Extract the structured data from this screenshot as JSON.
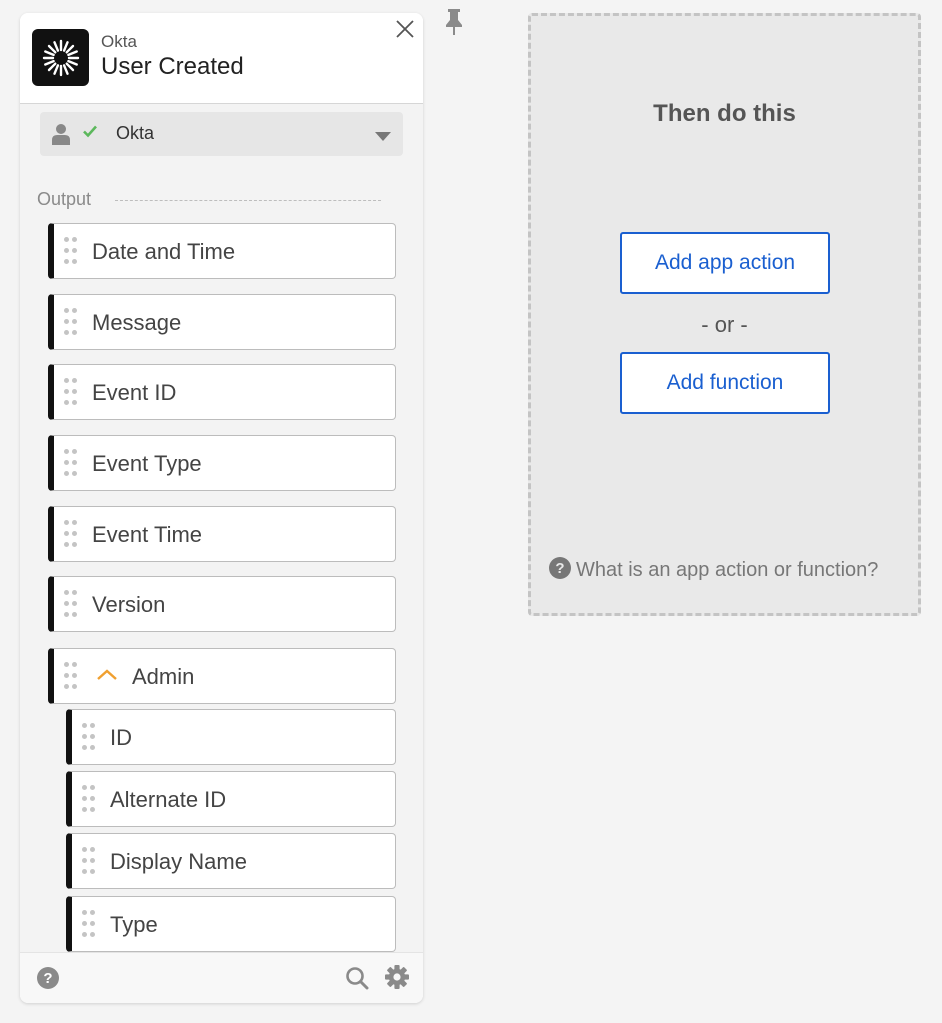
{
  "trigger": {
    "app_name": "Okta",
    "event_title": "User Created",
    "logo_icon": "okta-sunburst-logo",
    "account": {
      "name": "Okta",
      "status": "connected",
      "status_color": "#5cb85c"
    }
  },
  "output": {
    "label": "Output",
    "fields": [
      {
        "label": "Date and Time"
      },
      {
        "label": "Message"
      },
      {
        "label": "Event ID"
      },
      {
        "label": "Event Type"
      },
      {
        "label": "Event Time"
      },
      {
        "label": "Version"
      },
      {
        "label": "Admin",
        "expanded": true
      },
      {
        "label": "ID"
      },
      {
        "label": "Alternate ID"
      },
      {
        "label": "Display Name"
      },
      {
        "label": "Type"
      }
    ]
  },
  "actions": {
    "title": "Then do this",
    "add_app_action": "Add app action",
    "separator": "- or -",
    "add_function": "Add function",
    "help_text": "What is an app action or function?",
    "accent_color": "#1a5fd0"
  }
}
